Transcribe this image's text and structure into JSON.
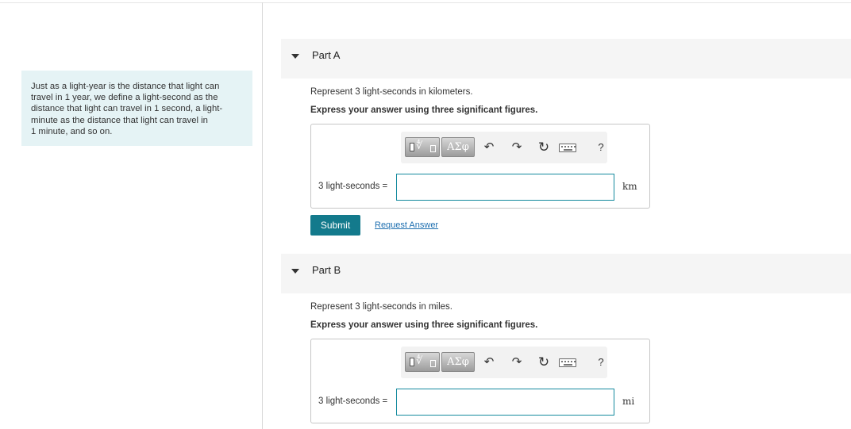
{
  "intro": {
    "lines": [
      "Just as a light-year is the distance that light can",
      "travel in 1 year, we define a light-second as the",
      "distance that light can travel in 1 second, a light-",
      "minute as the distance that light can travel in",
      "1 minute, and so on."
    ]
  },
  "parts": [
    {
      "title": "Part A",
      "question": "Represent 3 light-seconds in kilometers.",
      "instruction": "Express your answer using three significant figures.",
      "answer_label": "3 light-seconds =",
      "answer_value": "",
      "unit": "km",
      "toolbar": {
        "greek_label": "ΑΣφ",
        "help_label": "?"
      },
      "submit_label": "Submit",
      "request_label": "Request Answer"
    },
    {
      "title": "Part B",
      "question": "Represent 3 light-seconds in miles.",
      "instruction": "Express your answer using three significant figures.",
      "answer_label": "3 light-seconds =",
      "answer_value": "",
      "unit": "mi",
      "toolbar": {
        "greek_label": "ΑΣφ",
        "help_label": "?"
      }
    }
  ],
  "icons": {
    "collapse": "triangle-down-icon",
    "templates": "templates-icon",
    "undo": "undo-icon",
    "redo": "redo-icon",
    "reset": "reset-icon",
    "keyboard": "keyboard-icon",
    "help": "help-icon"
  },
  "colors": {
    "accent": "#137a8c",
    "link": "#1e6fb0",
    "intro_bg": "#e5f3f5",
    "part_header_bg": "#f5f5f5"
  }
}
